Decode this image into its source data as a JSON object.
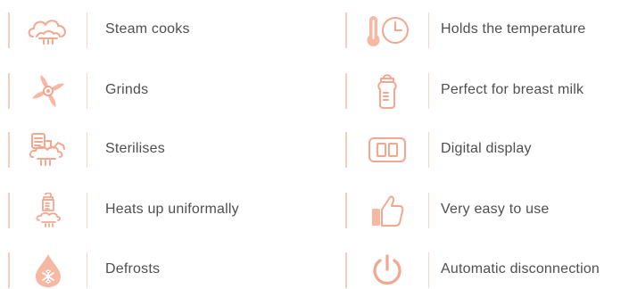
{
  "colors": {
    "accent": "#f4a78f",
    "accent_fill": "#f6b7a3",
    "text": "#4f4f4f",
    "divider": "#f3d5cb"
  },
  "features_left": [
    {
      "label": "Steam cooks",
      "icon": "steam-cloud-icon"
    },
    {
      "label": "Grinds",
      "icon": "blade-icon"
    },
    {
      "label": "Sterilises",
      "icon": "sterilise-icon"
    },
    {
      "label": "Heats up uniformally",
      "icon": "bottle-steam-icon"
    },
    {
      "label": "Defrosts",
      "icon": "snow-drop-icon"
    }
  ],
  "features_right": [
    {
      "label": "Holds the temperature",
      "icon": "thermometer-clock-icon"
    },
    {
      "label": "Perfect for breast milk",
      "icon": "baby-bottle-icon"
    },
    {
      "label": "Digital display",
      "icon": "digital-display-icon"
    },
    {
      "label": "Very easy to use",
      "icon": "thumbs-up-icon"
    },
    {
      "label": "Automatic disconnection",
      "icon": "power-icon"
    }
  ]
}
